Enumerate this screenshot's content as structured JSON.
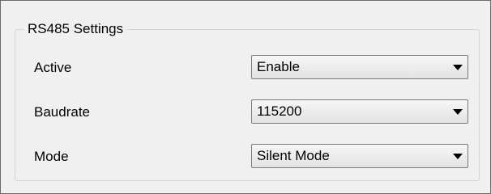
{
  "group": {
    "title": "RS485 Settings"
  },
  "settings": [
    {
      "label": "Active",
      "value": "Enable"
    },
    {
      "label": "Baudrate",
      "value": "115200"
    },
    {
      "label": "Mode",
      "value": "Silent Mode"
    }
  ]
}
